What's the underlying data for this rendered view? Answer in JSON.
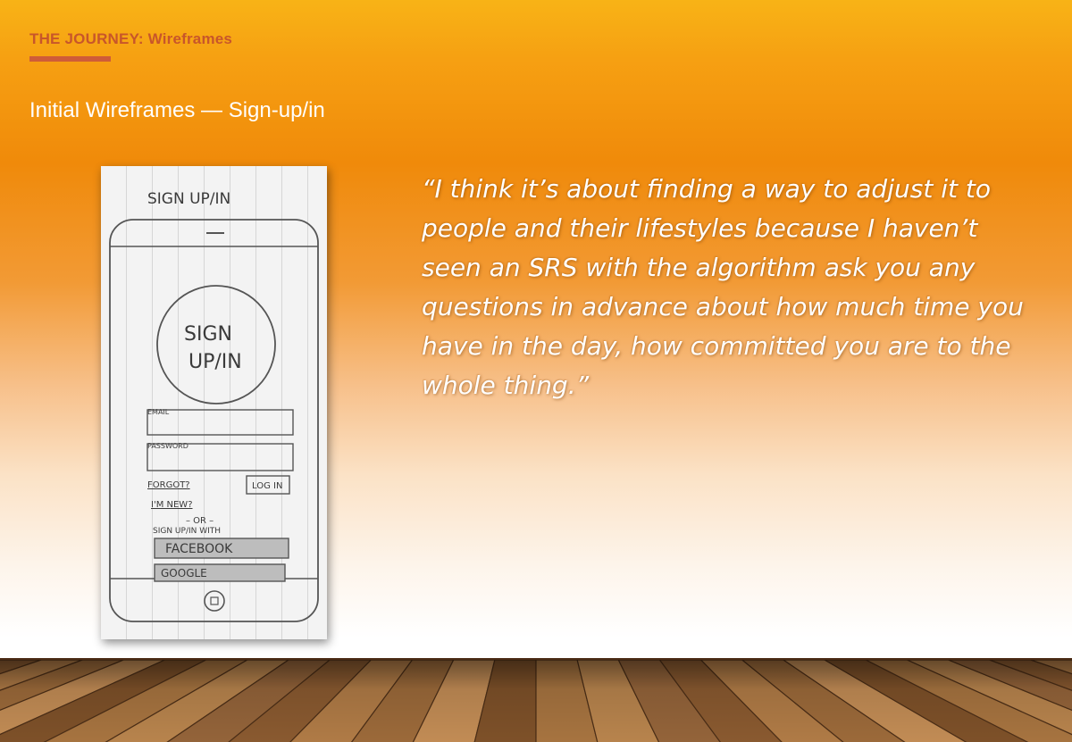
{
  "header": {
    "title": "THE JOURNEY: Wireframes"
  },
  "subtitle": "Initial Wireframes — Sign-up/in",
  "quote": "“I think it’s about finding a way to adjust it to people and their lifestyles because I haven’t seen an SRS with the algorithm ask you any questions in advance about how much time you have in the day, how committed you are to the whole thing.”",
  "sketch": {
    "title": "SIGN UP/IN",
    "circle_line1": "SIGN",
    "circle_line2": "UP/IN",
    "email_label": "EMAIL",
    "password_label": "PASSWORD",
    "forgot": "FORGOT?",
    "login": "LOG IN",
    "new": "I'M NEW?",
    "or": "– OR –",
    "with": "SIGN UP/IN  WITH",
    "facebook": "FACEBOOK",
    "google": "GOOGLE"
  },
  "colors": {
    "accent": "#c8562a",
    "underline": "#cf5c38",
    "quote_text": "#ffffff",
    "bg_top": "#f8b316",
    "bg_mid": "#f08a0a"
  }
}
